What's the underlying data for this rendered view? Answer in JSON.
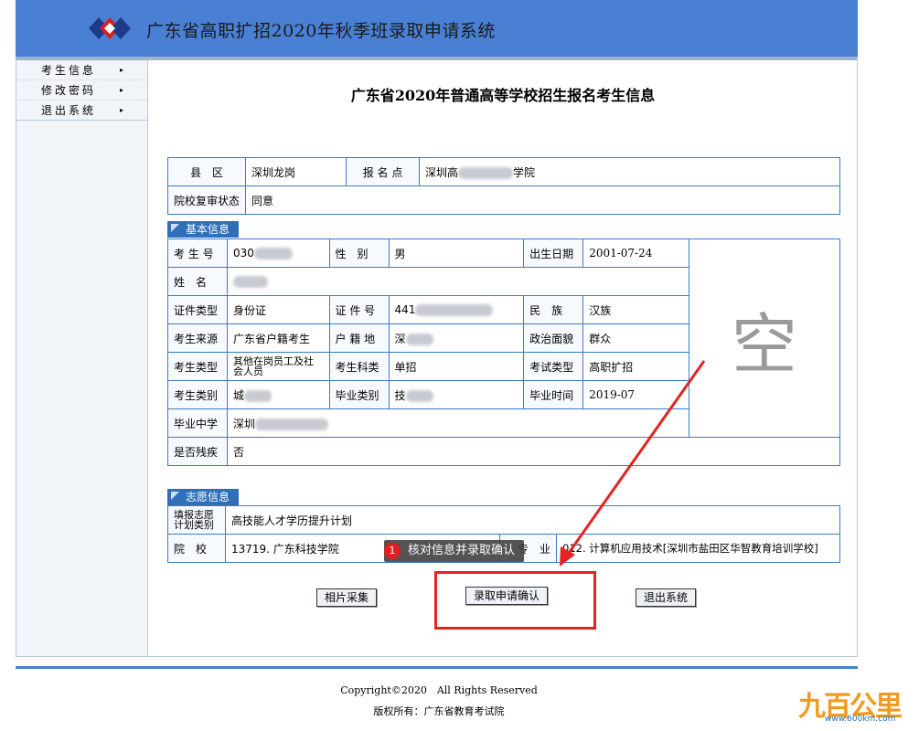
{
  "app": {
    "title": "广东省高职扩招2020年秋季班录取申请系统"
  },
  "sidebar": {
    "items": [
      {
        "label": "考生信息",
        "arrow": "▸"
      },
      {
        "label": "修改密码",
        "arrow": "▸"
      },
      {
        "label": "退出系统",
        "arrow": "▸"
      }
    ]
  },
  "page": {
    "title": "广东省2020年普通高等学校招生报名考生信息"
  },
  "top_table": {
    "county_label": "县　区",
    "county_value": "深圳龙岗",
    "site_label": "报 名 点",
    "site_value_prefix": "深圳高",
    "site_value_suffix": "学院",
    "review_label": "院校复审状态",
    "review_value": "同意"
  },
  "basic": {
    "section_label": "基本信息",
    "exam_no_label": "考 生 号",
    "exam_no_value": "030",
    "gender_label": "性　别",
    "gender_value": "男",
    "birth_label": "出生日期",
    "birth_value": "2001-07-24",
    "name_label": "姓　名",
    "id_type_label": "证件类型",
    "id_type_value": "身份证",
    "id_no_label": "证 件 号",
    "id_no_value": "441",
    "ethnic_label": "民　族",
    "ethnic_value": "汉族",
    "source_label": "考生来源",
    "source_value": "广东省户籍考生",
    "hukou_label": "户 籍 地",
    "hukou_value": "深",
    "political_label": "政治面貌",
    "political_value": "群众",
    "type_label": "考生类型",
    "type_value": "其他在岗员工及社会人员",
    "subject_label": "考生科类",
    "subject_value": "单招",
    "exam_type_label": "考试类型",
    "exam_type_value": "高职扩招",
    "category_label": "考生类别",
    "category_value": "城",
    "grad_type_label": "毕业类别",
    "grad_type_value": "技",
    "grad_time_label": "毕业时间",
    "grad_time_value": "2019-07",
    "school_label": "毕业中学",
    "school_value": "深圳",
    "disabled_label": "是否残疾",
    "disabled_value": "否",
    "photo_placeholder": "空"
  },
  "wish": {
    "section_label": "志愿信息",
    "plan_label": "填报志愿计划类别",
    "plan_value": "高技能人才学历提升计划",
    "college_label": "院　校",
    "college_value": "13719. 广东科技学院",
    "major_label": "专　业",
    "major_value": "012. 计算机应用技术[深圳市盐田区华智教育培训学校]"
  },
  "buttons": {
    "photo": "相片采集",
    "confirm": "录取申请确认",
    "exit": "退出系统"
  },
  "callout": {
    "number": "1",
    "text": "核对信息并录取确认"
  },
  "footer": {
    "copyright": "Copyright©2020　All Rights Reserved",
    "owner": "版权所有：广东省教育考试院"
  },
  "watermark": {
    "logo": "九百公里",
    "url": "www.600km.com"
  },
  "colors": {
    "header": "#4a80d4",
    "border": "#3a7bc8",
    "highlight": "#e52222"
  }
}
